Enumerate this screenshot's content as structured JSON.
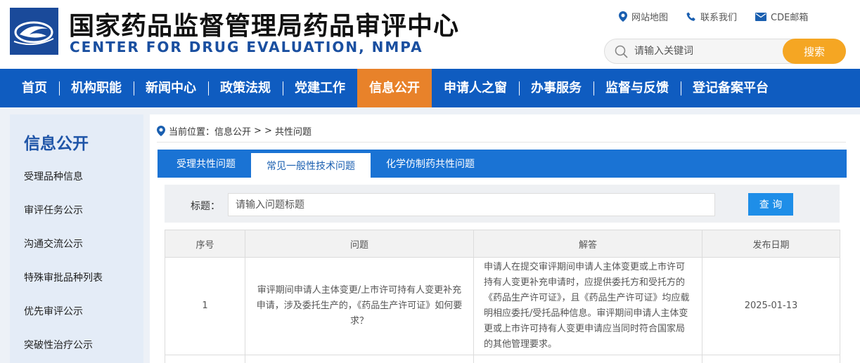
{
  "header": {
    "title_cn": "国家药品监督管理局药品审评中心",
    "title_en": "CENTER FOR DRUG EVALUATION, NMPA",
    "top_links": [
      {
        "label": "网站地图",
        "icon": "location-pin-icon"
      },
      {
        "label": "联系我们",
        "icon": "phone-icon"
      },
      {
        "label": "CDE邮箱",
        "icon": "mail-icon"
      }
    ],
    "search": {
      "placeholder": "请输入关键词",
      "button": "搜索"
    }
  },
  "nav": {
    "items": [
      "首页",
      "机构职能",
      "新闻中心",
      "政策法规",
      "党建工作",
      "信息公开",
      "申请人之窗",
      "办事服务",
      "监督与反馈",
      "登记备案平台"
    ],
    "active_index": 5
  },
  "sidebar": {
    "title": "信息公开",
    "items": [
      "受理品种信息",
      "审评任务公示",
      "沟通交流公示",
      "特殊审批品种列表",
      "优先审评公示",
      "突破性治疗公示"
    ]
  },
  "breadcrumb": {
    "prefix": "当前位置：信息公开",
    "sep": "> >",
    "current": "共性问题"
  },
  "tabs": {
    "items": [
      "受理共性问题",
      "常见一般性技术问题",
      "化学仿制药共性问题"
    ],
    "active_index": 1
  },
  "filter": {
    "label": "标题：",
    "placeholder": "请输入问题标题",
    "button": "查 询"
  },
  "table": {
    "headers": [
      "序号",
      "问题",
      "解答",
      "发布日期"
    ],
    "rows": [
      {
        "no": "1",
        "question": "审评期间申请人主体变更/上市许可持有人变更补充申请，涉及委托生产的，《药品生产许可证》如何要求？",
        "answer": "申请人在提交审评期间申请人主体变更或上市许可持有人变更补充申请时，应提供委托方和受托方的《药品生产许可证》，且《药品生产许可证》均应载明相应委托/受托品种信息。审评期间申请人主体变更或上市许可持有人变更申请应当同时符合国家局的其他管理要求。",
        "date": "2025-01-13"
      }
    ]
  },
  "colors": {
    "nav": "#0f5cc0",
    "nav_active": "#e8822a",
    "search_button": "#f5a623",
    "tab_bar": "#1a73d4",
    "query_button": "#1e8ee8"
  }
}
